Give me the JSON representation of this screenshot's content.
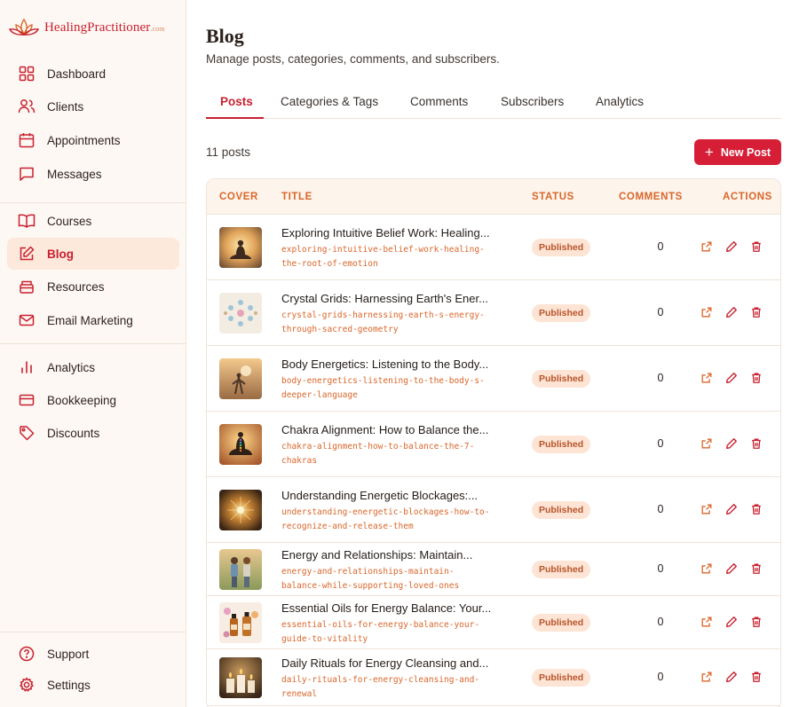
{
  "brand": {
    "name": "HealingPractitioner",
    "domain": ".com",
    "accent": "#c8202f",
    "orange": "#d9662a"
  },
  "sidebar": {
    "items": [
      {
        "label": "Dashboard",
        "icon": "grid-icon"
      },
      {
        "label": "Clients",
        "icon": "users-icon"
      },
      {
        "label": "Appointments",
        "icon": "calendar-icon"
      },
      {
        "label": "Messages",
        "icon": "message-icon"
      },
      {
        "label": "Courses",
        "icon": "book-icon"
      },
      {
        "label": "Blog",
        "icon": "edit-icon",
        "active": true
      },
      {
        "label": "Resources",
        "icon": "archive-icon"
      },
      {
        "label": "Email Marketing",
        "icon": "mail-icon"
      },
      {
        "label": "Analytics",
        "icon": "bar-chart-icon"
      },
      {
        "label": "Bookkeeping",
        "icon": "credit-card-icon"
      },
      {
        "label": "Discounts",
        "icon": "tag-icon"
      }
    ],
    "footer": [
      {
        "label": "Support",
        "icon": "help-icon"
      },
      {
        "label": "Settings",
        "icon": "gear-icon"
      }
    ]
  },
  "page": {
    "title": "Blog",
    "subtitle": "Manage posts, categories, comments, and subscribers.",
    "tabs": [
      "Posts",
      "Categories & Tags",
      "Comments",
      "Subscribers",
      "Analytics"
    ],
    "active_tab": "Posts",
    "post_count": "11 posts",
    "new_post_label": "New Post"
  },
  "table": {
    "columns": [
      "COVER",
      "TITLE",
      "STATUS",
      "COMMENTS",
      "ACTIONS"
    ],
    "rows": [
      {
        "title": "Exploring Intuitive Belief Work: Healing...",
        "slug": [
          "exploring-intuitive-belief-work-healing-",
          "the-root-of-emotion"
        ],
        "status": "Published",
        "comments": "0",
        "cover": "meditation-silhouette"
      },
      {
        "title": "Crystal Grids: Harnessing Earth's Ener...",
        "slug": [
          "crystal-grids-harnessing-earth-s-energy-",
          "through-sacred-geometry"
        ],
        "status": "Published",
        "comments": "0",
        "cover": "crystal-grid"
      },
      {
        "title": "Body Energetics: Listening to the Body...",
        "slug": [
          "body-energetics-listening-to-the-body-s-",
          "deeper-language"
        ],
        "status": "Published",
        "comments": "0",
        "cover": "figure-sunset"
      },
      {
        "title": "Chakra Alignment: How to Balance the...",
        "slug": [
          "chakra-alignment-how-to-balance-the-7-",
          "chakras"
        ],
        "status": "Published",
        "comments": "0",
        "cover": "chakra-meditation"
      },
      {
        "title": "Understanding Energetic Blockages:...",
        "slug": [
          "understanding-energetic-blockages-how-to-",
          "recognize-and-release-them"
        ],
        "status": "Published",
        "comments": "0",
        "cover": "energy-glow"
      },
      {
        "title": "Energy and Relationships: Maintain...",
        "slug": [
          "energy-and-relationships-maintain-",
          "balance-while-supporting-loved-ones"
        ],
        "status": "Published",
        "comments": "0",
        "cover": "two-women"
      },
      {
        "title": "Essential Oils for Energy Balance: Your...",
        "slug": [
          "essential-oils-for-energy-balance-your-",
          "guide-to-vitality"
        ],
        "status": "Published",
        "comments": "0",
        "cover": "oil-bottles"
      },
      {
        "title": "Daily Rituals for Energy Cleansing and...",
        "slug": [
          "daily-rituals-for-energy-cleansing-and-",
          "renewal"
        ],
        "status": "Published",
        "comments": "0",
        "cover": "candles"
      }
    ]
  }
}
